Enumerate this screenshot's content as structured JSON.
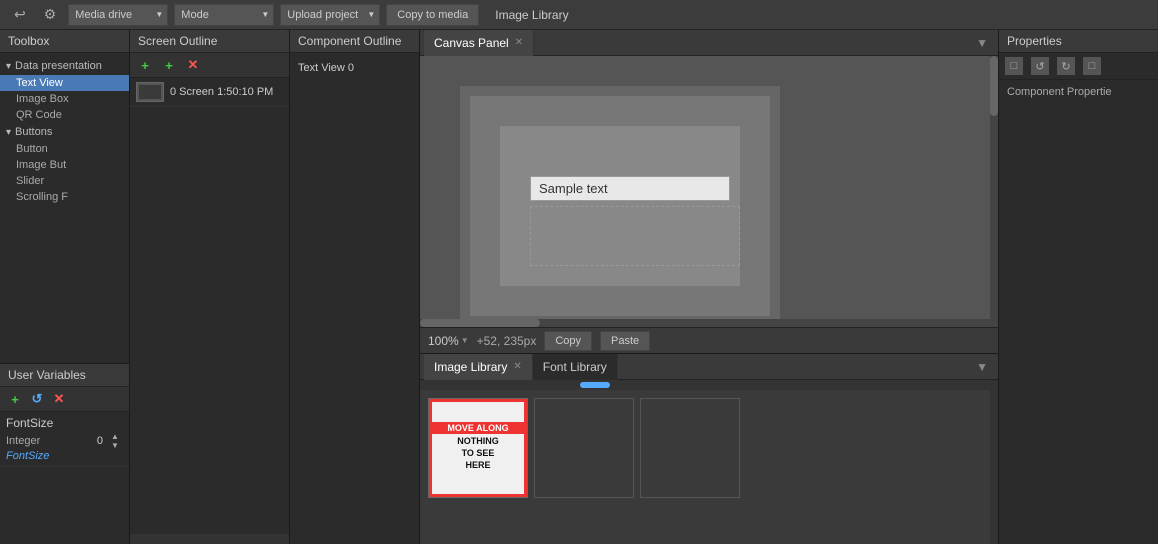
{
  "toolbar": {
    "back_label": "↩",
    "gear_label": "⚙",
    "media_drive_label": "Media drive",
    "mode_label": "Mode",
    "upload_label": "Upload project",
    "copy_to_media_label": "Copy to media",
    "image_library_title": "Image Library"
  },
  "toolbox": {
    "header": "Toolbox",
    "groups": [
      {
        "name": "Data presentation",
        "items": [
          "Text View",
          "Image Box",
          "QR Code"
        ]
      },
      {
        "name": "Buttons",
        "items": [
          "Button",
          "Image But",
          "Slider",
          "Scrolling F"
        ]
      }
    ],
    "selected_item": "Text View"
  },
  "screen_outline": {
    "header": "Screen Outline",
    "add_label": "+",
    "remove_label": "✕",
    "items": [
      {
        "label": "0 Screen 1:50:10 PM"
      }
    ]
  },
  "component_outline": {
    "header": "Component Outline",
    "items": [
      "Text View 0"
    ]
  },
  "user_variables": {
    "header": "User Variables",
    "add_label": "+",
    "refresh_label": "↺",
    "remove_label": "✕",
    "variables": [
      {
        "name": "FontSize",
        "subname": "FontSize",
        "type": "Integer",
        "value": "0"
      }
    ]
  },
  "canvas_panel": {
    "tab_label": "Canvas Panel",
    "tab_close": "✕",
    "minimize_label": "▼",
    "sample_text": "Sample text",
    "zoom": "100%",
    "zoom_arrow": "▼",
    "coords": "+52, 235px",
    "copy_label": "Copy",
    "paste_label": "Paste"
  },
  "bottom_tabs": {
    "image_library_label": "Image Library",
    "image_library_close": "✕",
    "font_library_label": "Font Library",
    "minimize_label": "▼",
    "image1": {
      "title": "MOVE ALONG",
      "line1": "NOTHING",
      "line2": "TO SEE",
      "line3": "HERE"
    }
  },
  "properties": {
    "header": "Properties",
    "icons": [
      "□",
      "↺",
      "↻",
      "□"
    ],
    "component_label": "Component Propertie"
  }
}
